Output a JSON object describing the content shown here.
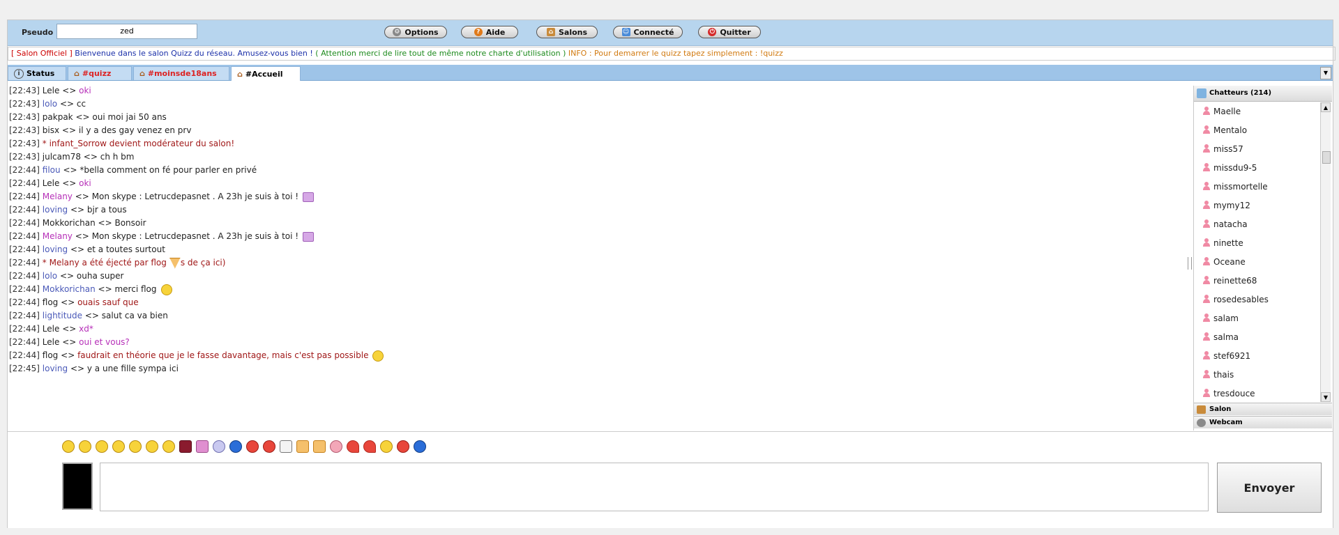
{
  "topbar": {
    "pseudo_label": "Pseudo",
    "pseudo_value": "zed",
    "buttons": [
      {
        "label": "Options",
        "icon": "gear-icon"
      },
      {
        "label": "Aide",
        "icon": "help-icon"
      },
      {
        "label": "Salons",
        "icon": "home-icon"
      },
      {
        "label": "Connecté",
        "icon": "users-icon"
      },
      {
        "label": "Quitter",
        "icon": "power-icon"
      }
    ]
  },
  "infobar": {
    "salon": "[ Salon Officiel ]",
    "welcome": "Bienvenue dans le salon Quizz du réseau. Amusez-vous bien !",
    "notice": "( Attention merci de lire tout de même notre charte d'utilisation )",
    "info": "INFO : Pour demarrer le quizz tapez simplement : !quizz"
  },
  "tabs": [
    {
      "label": "Status",
      "icon": "info-icon"
    },
    {
      "label": "#quizz",
      "icon": "home-icon"
    },
    {
      "label": "#moinsde18ans",
      "icon": "home-icon"
    },
    {
      "label": "#Accueil",
      "icon": "home-icon"
    }
  ],
  "chat": {
    "lines": [
      {
        "ts": "[22:43]",
        "nick": "Lele",
        "sep": "<>",
        "msg": "oki"
      },
      {
        "ts": "[22:43]",
        "nick": "lolo",
        "sep": "<>",
        "msg": "cc"
      },
      {
        "ts": "[22:43]",
        "nick": "pakpak",
        "sep": "<>",
        "msg": "oui moi jai 50 ans"
      },
      {
        "ts": "[22:43]",
        "nick": "bisx",
        "sep": "<>",
        "msg": "il y a des gay venez en prv"
      },
      {
        "ts": "[22:43]",
        "nick": "",
        "sep": "",
        "msg": "* infant_Sorrow devient modérateur du salon!"
      },
      {
        "ts": "[22:43]",
        "nick": "julcam78",
        "sep": "<>",
        "msg": "ch h bm"
      },
      {
        "ts": "[22:44]",
        "nick": "filou",
        "sep": "<>",
        "msg": "*bella comment on fé pour parler en privé"
      },
      {
        "ts": "[22:44]",
        "nick": "Lele",
        "sep": "<>",
        "msg": "oki"
      },
      {
        "ts": "[22:44]",
        "nick": "Melany",
        "sep": "<>",
        "msg": "Mon skype : Letrucdepasnet . A 23h je suis à toi !"
      },
      {
        "ts": "[22:44]",
        "nick": "loving",
        "sep": "<>",
        "msg": "bjr a tous"
      },
      {
        "ts": "[22:44]",
        "nick": "Mokkorichan",
        "sep": "<>",
        "msg": "Bonsoir"
      },
      {
        "ts": "[22:44]",
        "nick": "Melany",
        "sep": "<>",
        "msg": "Mon skype : Letrucdepasnet . A 23h je suis à toi !"
      },
      {
        "ts": "[22:44]",
        "nick": "loving",
        "sep": "<>",
        "msg": "et a toutes surtout"
      },
      {
        "ts": "[22:44]",
        "nick": "",
        "sep": "",
        "msg": "* Melany a été éjecté par flog",
        "tail": "s de ça ici)"
      },
      {
        "ts": "[22:44]",
        "nick": "lolo",
        "sep": "<>",
        "msg": "ouha super"
      },
      {
        "ts": "[22:44]",
        "nick": "Mokkorichan",
        "sep": "<>",
        "msg": "merci flog"
      },
      {
        "ts": "[22:44]",
        "nick": "flog",
        "sep": "<>",
        "msg": "ouais sauf que"
      },
      {
        "ts": "[22:44]",
        "nick": "lightitude",
        "sep": "<>",
        "msg": "salut ca va bien"
      },
      {
        "ts": "[22:44]",
        "nick": "Lele",
        "sep": "<>",
        "msg": "xd*"
      },
      {
        "ts": "[22:44]",
        "nick": "Lele",
        "sep": "<>",
        "msg": "oui et vous?"
      },
      {
        "ts": "[22:44]",
        "nick": "flog",
        "sep": "<>",
        "msg": "faudrait en théorie que je le fasse davantage, mais c'est pas possible"
      },
      {
        "ts": "[22:45]",
        "nick": "loving",
        "sep": "<>",
        "msg": "y a une fille sympa ici"
      }
    ]
  },
  "users": {
    "header": "Chatteurs (214)",
    "list": [
      "Maelle",
      "Mentalo",
      "miss57",
      "missdu9-5",
      "missmortelle",
      "mymy12",
      "natacha",
      "ninette",
      "Oceane",
      "reinette68",
      "rosedesables",
      "salam",
      "salma",
      "stef6921",
      "thais",
      "tresdouce"
    ],
    "salon_btn": "Salon",
    "webcam_btn": "Webcam"
  },
  "composer": {
    "send_label": "Envoyer",
    "message_value": ""
  }
}
